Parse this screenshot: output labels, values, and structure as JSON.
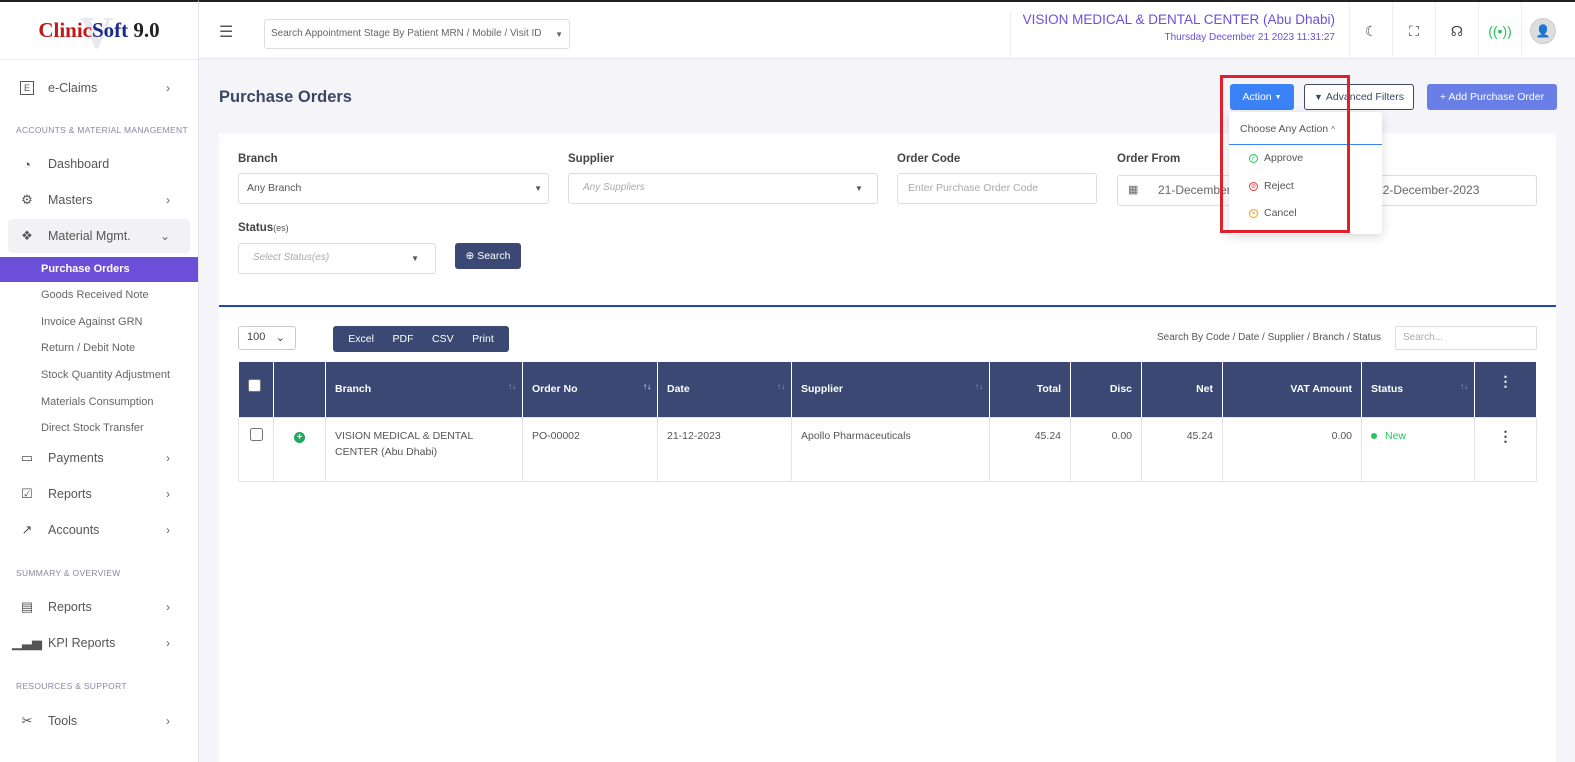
{
  "app": {
    "logo_prefix": "Clinic",
    "logo_suffix": "Soft",
    "version": "9.0",
    "watermark": "V"
  },
  "sidebar": {
    "eclaims": "e-Claims",
    "section1": "ACCOUNTS & MATERIAL MANAGEMENT",
    "dashboard": "Dashboard",
    "masters": "Masters",
    "material": "Material Mgmt.",
    "sub_items": [
      "Purchase Orders",
      "Goods Received Note",
      "Invoice Against GRN",
      "Return / Debit Note",
      "Stock Quantity Adjustment",
      "Materials Consumption",
      "Direct Stock Transfer"
    ],
    "payments": "Payments",
    "reports": "Reports",
    "accounts": "Accounts",
    "section2": "SUMMARY & OVERVIEW",
    "reports2": "Reports",
    "kpi": "KPI Reports",
    "section3": "RESOURCES & SUPPORT",
    "tools": "Tools"
  },
  "topbar": {
    "search_placeholder": "Search Appointment Stage By Patient MRN / Mobile / Visit ID",
    "clinic_name": "VISION MEDICAL & DENTAL CENTER (Abu Dhabi)",
    "datetime": "Thursday December 21 2023 11:31:27"
  },
  "page": {
    "title": "Purchase Orders",
    "action": "Action",
    "advanced": "Advanced Filters",
    "add": "+ Add Purchase Order"
  },
  "filters": {
    "branch_label": "Branch",
    "branch_value": "Any Branch",
    "supplier_label": "Supplier",
    "supplier_placeholder": "Any Suppliers",
    "code_label": "Order Code",
    "code_placeholder": "Enter Purchase Order Code",
    "from_label": "Order From",
    "from_value": "21-December-2023",
    "to_value": "22-December-2023",
    "status_label": "Status",
    "status_suffix": "(es)",
    "status_placeholder": "Select Status(es)",
    "search": "Search"
  },
  "table_tools": {
    "per_page": "100",
    "export": [
      "Excel",
      "PDF",
      "CSV",
      "Print"
    ],
    "search_hint": "Search By Code / Date / Supplier / Branch / Status",
    "search_placeholder": "Search..."
  },
  "table": {
    "headers": [
      "Branch",
      "Order No",
      "Date",
      "Supplier",
      "Total",
      "Disc",
      "Net",
      "VAT Amount",
      "Status"
    ],
    "rows": [
      {
        "branch": "VISION MEDICAL & DENTAL CENTER (Abu Dhabi)",
        "order_no": "PO-00002",
        "date": "21-12-2023",
        "supplier": "Apollo Pharmaceuticals",
        "total": "45.24",
        "disc": "0.00",
        "net": "45.24",
        "vat": "0.00",
        "status": "New"
      }
    ]
  },
  "dropdown": {
    "header": "Choose Any Action",
    "items": [
      "Approve",
      "Reject",
      "Cancel"
    ],
    "colors": {
      "approve": "#22c55e",
      "reject": "#e53935",
      "cancel": "#f59e0b"
    }
  },
  "colors": {
    "primary": "#6c4fd8",
    "navy": "#3b4873",
    "action_blue": "#3b82f6",
    "highlight": "#e0202a"
  }
}
